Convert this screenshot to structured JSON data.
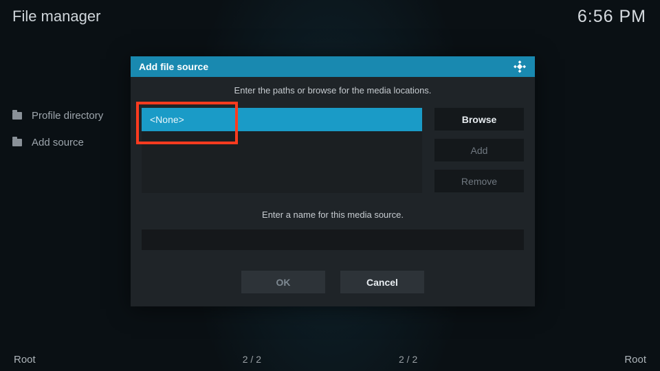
{
  "header": {
    "title": "File manager",
    "clock": "6:56 PM"
  },
  "sidebar": {
    "items": [
      {
        "label": "Profile directory"
      },
      {
        "label": "Add source"
      }
    ]
  },
  "dialog": {
    "title": "Add file source",
    "instruction": "Enter the paths or browse for the media locations.",
    "path_value": "<None>",
    "browse_label": "Browse",
    "add_label": "Add",
    "remove_label": "Remove",
    "name_prompt": "Enter a name for this media source.",
    "name_value": "",
    "ok_label": "OK",
    "cancel_label": "Cancel"
  },
  "footer": {
    "left_root": "Root",
    "left_count": "2 / 2",
    "right_count": "2 / 2",
    "right_root": "Root"
  }
}
